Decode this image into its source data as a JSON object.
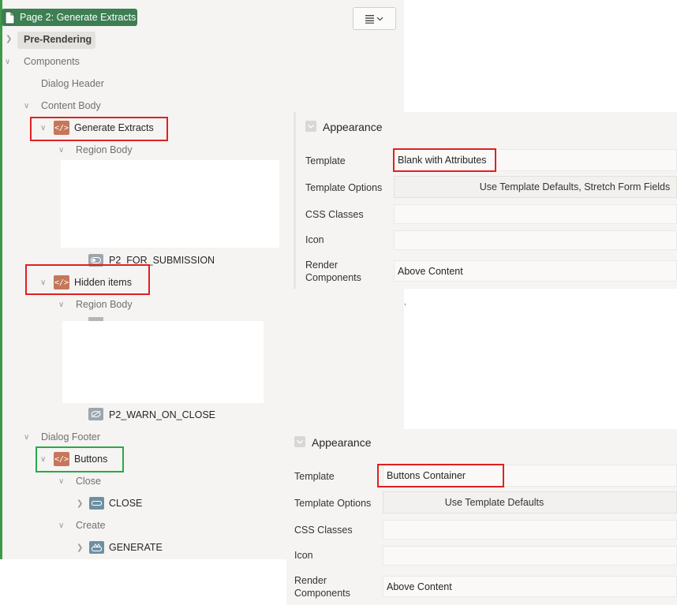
{
  "page_chip": {
    "label": "Page 2: Generate Extracts",
    "icon": "page-icon"
  },
  "menu_button": {
    "icon": "hamburger-menu-icon"
  },
  "tree": {
    "pre_rendering": "Pre-Rendering",
    "components": "Components",
    "dialog_header": "Dialog Header",
    "content_body": "Content Body",
    "generate_extracts": "Generate Extracts",
    "region_body_1": "Region Body",
    "p2_for_submission": "P2_FOR_SUBMISSION",
    "hidden_items": "Hidden items",
    "region_body_2": "Region Body",
    "p2_warn_on_close": "P2_WARN_ON_CLOSE",
    "dialog_footer": "Dialog Footer",
    "buttons": "Buttons",
    "close_group": "Close",
    "close_button": "CLOSE",
    "create_group": "Create",
    "generate_button": "GENERATE"
  },
  "panel1": {
    "title": "Appearance",
    "template_label": "Template",
    "template_value": "Blank with Attributes",
    "template_options_label": "Template Options",
    "template_options_value": "Use Template Defaults, Stretch Form Fields",
    "css_classes_label": "CSS Classes",
    "icon_label": "Icon",
    "render_label_1": "Render",
    "render_label_2": "Components",
    "render_value": "Above Content"
  },
  "panel2": {
    "title": "Appearance",
    "template_label": "Template",
    "template_value": "Buttons Container",
    "template_options_label": "Template Options",
    "template_options_value": "Use Template Defaults",
    "css_classes_label": "CSS Classes",
    "icon_label": "Icon",
    "render_label_1": "Render",
    "render_label_2": "Components",
    "render_value": "Above Content"
  },
  "colors": {
    "page_chip": "#3d7e52",
    "region_icon": "#c6775a",
    "highlight_red": "#e02020",
    "highlight_green": "#2aa84a"
  }
}
